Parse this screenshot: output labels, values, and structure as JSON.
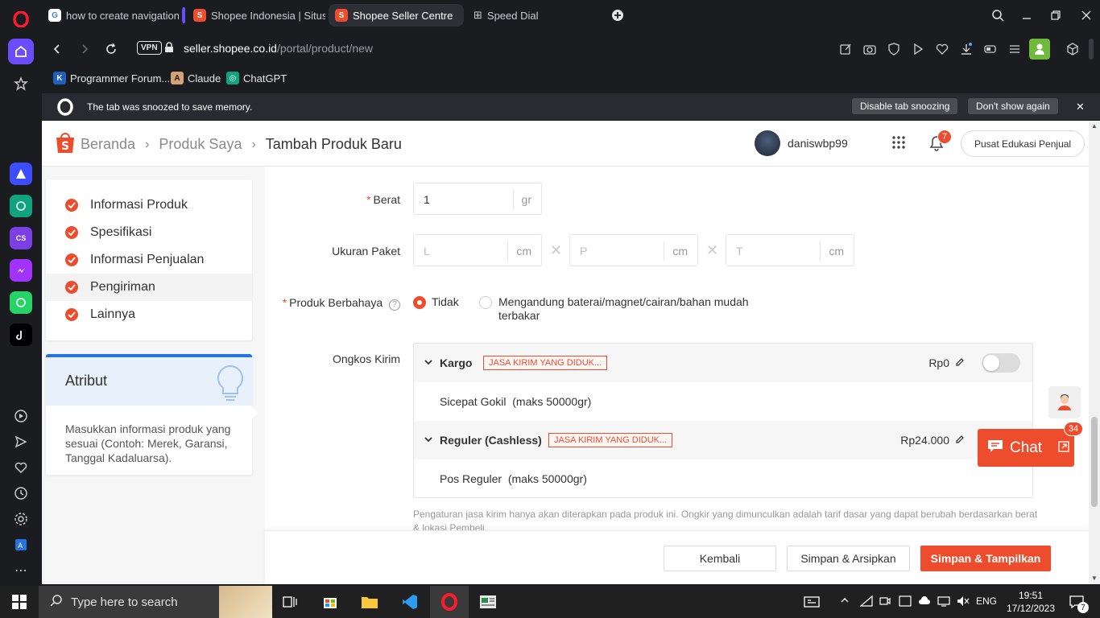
{
  "browser": {
    "tabs": [
      {
        "label": "how to create navigation b",
        "active": false
      },
      {
        "label": "Shopee Indonesia | Situs B",
        "active": false
      },
      {
        "label": "Shopee Seller Centre",
        "active": true
      },
      {
        "label": "Speed Dial",
        "active": false
      }
    ],
    "vpn_label": "VPN",
    "url_host": "seller.shopee.co.id",
    "url_path": "/portal/product/new",
    "bookmarks": [
      "Programmer Forum...",
      "Claude",
      "ChatGPT"
    ],
    "snooze_message": "The tab was snoozed to save memory.",
    "snooze_disable": "Disable tab snoozing",
    "snooze_dont_show": "Don't show again"
  },
  "header": {
    "crumb_home": "Beranda",
    "crumb_products": "Produk Saya",
    "crumb_current": "Tambah Produk Baru",
    "username": "daniswbp99",
    "notif_count": "7",
    "edu_button": "Pusat Edukasi Penjual"
  },
  "steps": [
    {
      "label": "Informasi Produk",
      "active": false
    },
    {
      "label": "Spesifikasi",
      "active": false
    },
    {
      "label": "Informasi Penjualan",
      "active": false
    },
    {
      "label": "Pengiriman",
      "active": true
    },
    {
      "label": "Lainnya",
      "active": false
    }
  ],
  "attribute_card": {
    "title": "Atribut",
    "description": "Masukkan informasi produk yang sesuai (Contoh: Merek, Garansi, Tanggal Kadaluarsa)."
  },
  "form": {
    "weight_label": "Berat",
    "weight_value": "1",
    "weight_unit": "gr",
    "package_label": "Ukuran Paket",
    "dims": [
      {
        "placeholder": "L",
        "unit": "cm"
      },
      {
        "placeholder": "P",
        "unit": "cm"
      },
      {
        "placeholder": "T",
        "unit": "cm"
      }
    ],
    "dangerous_label": "Produk Berbahaya",
    "dangerous_no": "Tidak",
    "dangerous_yes": "Mengandung baterai/magnet/cairan/bahan mudah terbakar",
    "shipping_label": "Ongkos Kirim",
    "shipping_groups": [
      {
        "name": "Kargo",
        "tag": "JASA KIRIM YANG DIDUK...",
        "price": "Rp0",
        "service": "Sicepat Gokil",
        "limit": "(maks 50000gr)"
      },
      {
        "name": "Reguler (Cashless)",
        "tag": "JASA KIRIM YANG DIDUK...",
        "price": "Rp24.000",
        "service": "Pos Reguler",
        "limit": "(maks 50000gr)"
      }
    ],
    "shipping_note": "Pengaturan jasa kirim hanya akan diterapkan pada produk ini. Ongkir yang dimunculkan adalah tarif dasar yang dapat berubah berdasarkan berat & lokasi Pembeli."
  },
  "footer": {
    "back": "Kembali",
    "save_archive": "Simpan & Arsipkan",
    "save_publish": "Simpan & Tampilkan"
  },
  "chat": {
    "label": "Chat",
    "badge": "34"
  },
  "taskbar": {
    "search_placeholder": "Type here to search",
    "lang": "ENG",
    "time": "19:51",
    "date": "17/12/2023",
    "notif": "7"
  },
  "colors": {
    "shopee_orange": "#ee4d2d",
    "opera_red": "#ff1b2d",
    "info_blue": "#2673dd"
  }
}
